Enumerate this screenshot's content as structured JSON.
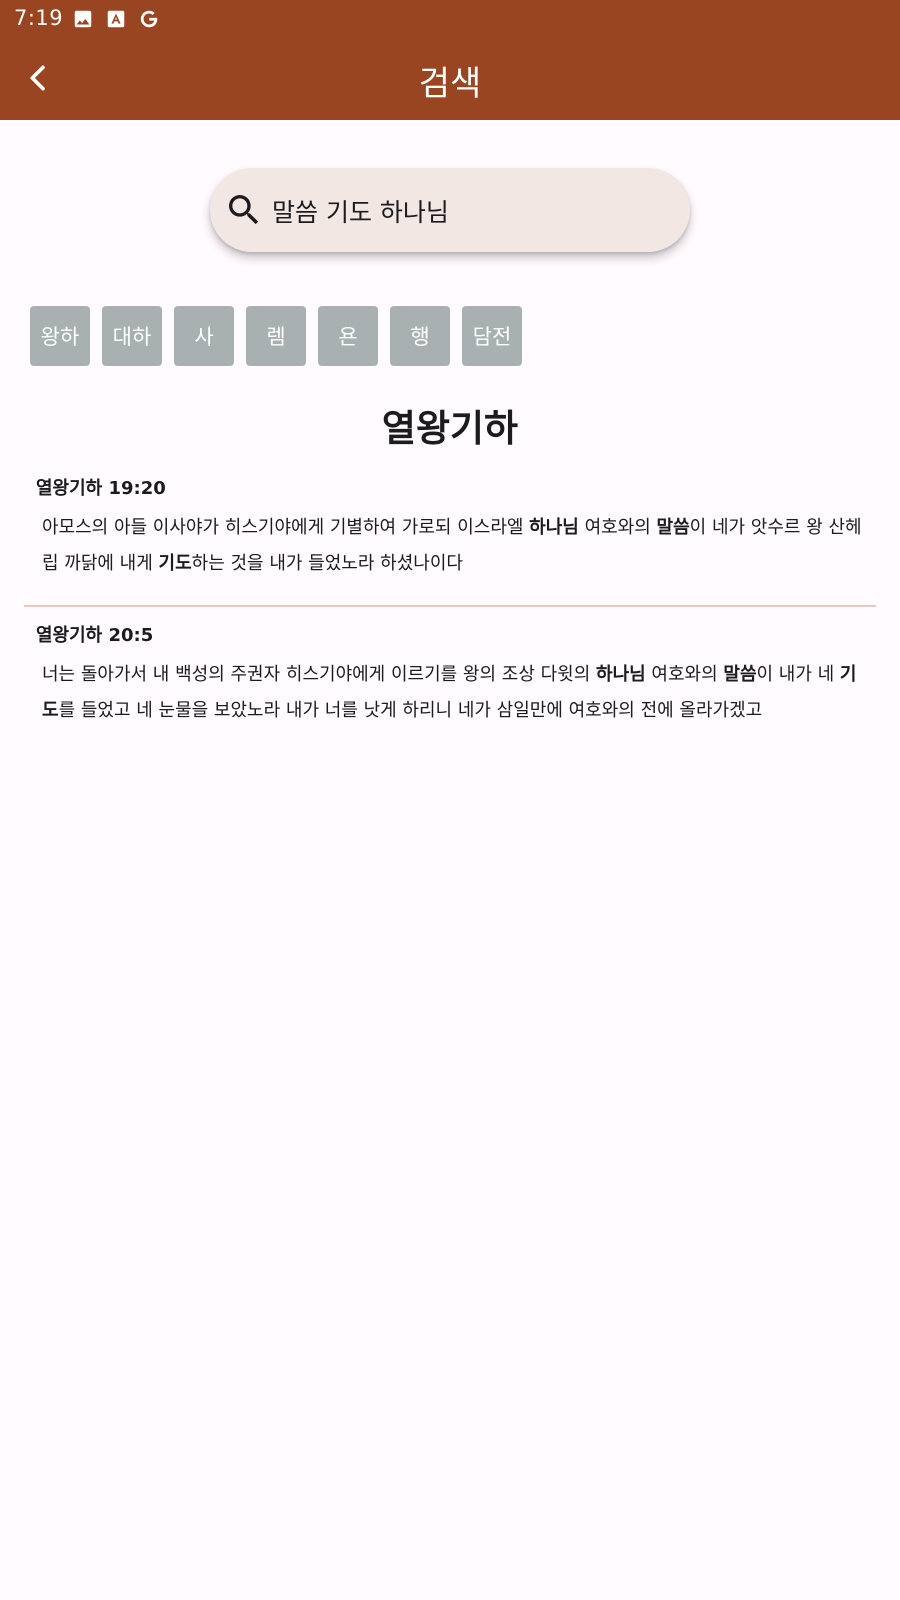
{
  "status_bar": {
    "time": "7:19",
    "icons": [
      "image-icon",
      "text-a-icon",
      "google-g-icon"
    ]
  },
  "app_bar": {
    "title": "검색",
    "back_icon": "chevron-left-icon"
  },
  "search": {
    "icon": "search-icon",
    "query": "말씀 기도 하나님"
  },
  "book_chips": [
    "왕하",
    "대하",
    "사",
    "렘",
    "욘",
    "행",
    "담전"
  ],
  "section_title": "열왕기하",
  "results": [
    {
      "reference": "열왕기하 19:20",
      "segments": [
        {
          "text": "아모스의 아들 이사야가 히스기야에게 기별하여 가로되 이스라엘 ",
          "bold": false
        },
        {
          "text": "하나님",
          "bold": true
        },
        {
          "text": " 여호와의 ",
          "bold": false
        },
        {
          "text": "말씀",
          "bold": true
        },
        {
          "text": "이 네가 앗수르 왕 산헤립 까닭에 내게 ",
          "bold": false
        },
        {
          "text": "기도",
          "bold": true
        },
        {
          "text": "하는 것을 내가 들었노라 하셨나이다",
          "bold": false
        }
      ]
    },
    {
      "reference": "열왕기하 20:5",
      "segments": [
        {
          "text": "너는 돌아가서 내 백성의 주권자 히스기야에게 이르기를 왕의 조상 다윗의 ",
          "bold": false
        },
        {
          "text": "하나님",
          "bold": true
        },
        {
          "text": " 여호와의 ",
          "bold": false
        },
        {
          "text": "말씀",
          "bold": true
        },
        {
          "text": "이 내가 네 ",
          "bold": false
        },
        {
          "text": "기도",
          "bold": true
        },
        {
          "text": "를 들었고 네 눈물을 보았노라 내가 너를 낫게 하리니 네가 삼일만에 여호와의 전에 올라가겠고",
          "bold": false
        }
      ]
    }
  ],
  "colors": {
    "primary": "#9a4522",
    "search_bg": "#f2e7e3",
    "chip_bg": "#a9b0b2",
    "divider": "#e7c9bd",
    "background": "#fffbfe"
  }
}
